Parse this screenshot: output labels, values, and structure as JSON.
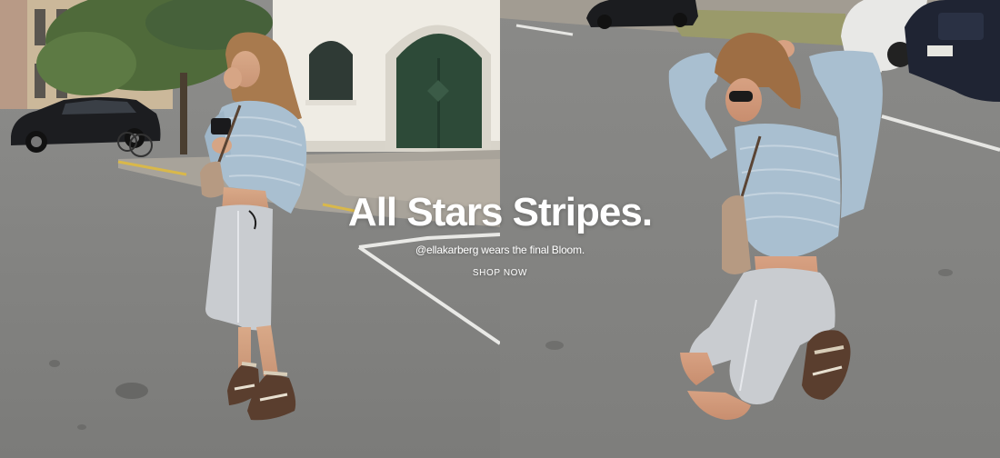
{
  "hero": {
    "headline": "All Stars Stripes.",
    "subline": "@ellakarberg wears the final Bloom.",
    "cta_label": "SHOP NOW"
  },
  "colors": {
    "text": "#ffffff",
    "asphalt": "#8c8c8a",
    "building": "#efece4",
    "door": "#2d4a38",
    "sweatshirt": "#a9bfd0",
    "shorts": "#c9ccd0",
    "shoes": "#5a3e2e"
  },
  "images": {
    "left_panel": "woman-standing-on-street-photo",
    "right_panel": "woman-kneeling-on-street-photo"
  }
}
